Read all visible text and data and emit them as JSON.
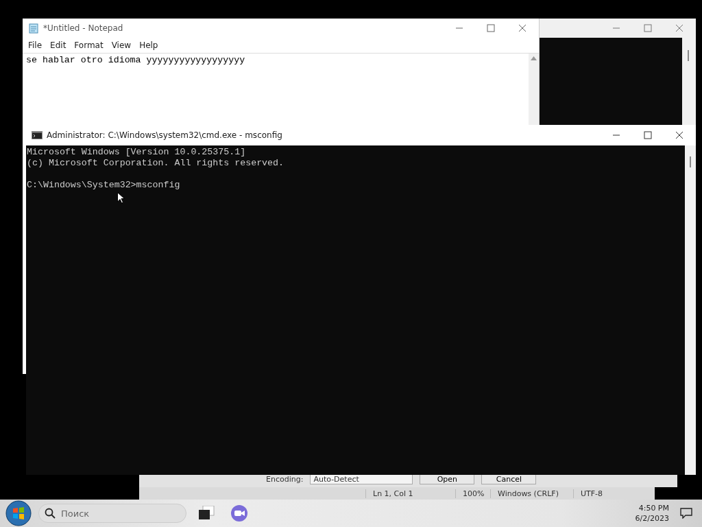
{
  "notepad": {
    "title": "*Untitled - Notepad",
    "menu": [
      "File",
      "Edit",
      "Format",
      "View",
      "Help"
    ],
    "text": "se hablar otro idioma yyyyyyyyyyyyyyyyyy"
  },
  "open_dialog": {
    "encoding_label": "Encoding:",
    "encoding_value": "Auto-Detect",
    "buttons": [
      "Open",
      "Cancel"
    ]
  },
  "notepad_status_bar": [
    "Ln 1, Col 1",
    "100%",
    "Windows (CRLF)",
    "UTF-8"
  ],
  "cmd": {
    "title": "Administrator: C:\\Windows\\system32\\cmd.exe - msconfig",
    "lines": [
      "Microsoft Windows [Version 10.0.25375.1]",
      "(c) Microsoft Corporation. All rights reserved."
    ],
    "prompt": "C:\\Windows\\System32>msconfig"
  },
  "taskbar": {
    "search_placeholder": "Поиск",
    "time": "4:50 PM",
    "date": "6/2/2023"
  }
}
